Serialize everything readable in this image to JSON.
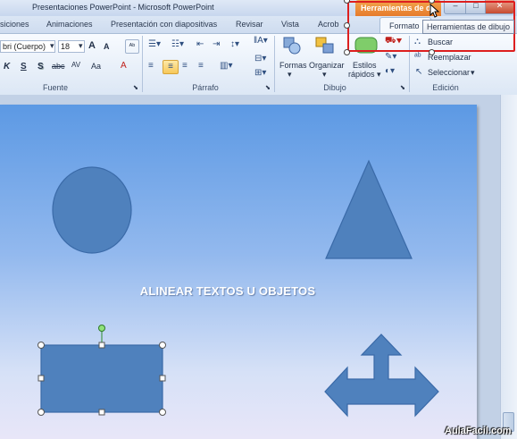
{
  "window": {
    "title": "Presentaciones PowerPoint - Microsoft PowerPoint",
    "contextual_tab": "Herramientas de d",
    "controls": {
      "minimize": "–",
      "maximize": "□",
      "close": "✕"
    }
  },
  "tabs": [
    "siciones",
    "Animaciones",
    "Presentación con diapositivas",
    "Revisar",
    "Vista",
    "Acrob",
    "Formato"
  ],
  "tooltip": "Herramientas de dibujo",
  "ribbon": {
    "font_group": {
      "label": "Fuente",
      "font_name": "bri (Cuerpo)",
      "font_size": "18",
      "grow": "A",
      "shrink": "A",
      "clear": "ᴬᵇ",
      "italic": "K",
      "underline": "S",
      "shadow": "S",
      "strike": "abc",
      "spacing": "AV",
      "case": "Aa",
      "color": "A"
    },
    "paragraph_group": {
      "label": "Párrafo"
    },
    "drawing_group": {
      "label": "Dibujo",
      "shapes": "Formas",
      "arrange": "Organizar",
      "styles_line1": "Estilos",
      "styles_line2": "rápidos"
    },
    "editing_group": {
      "label": "Edición",
      "find": "Buscar",
      "replace": "Reemplazar",
      "select": "Seleccionar"
    }
  },
  "slide": {
    "title_text": "ALINEAR TEXTOS U OBJETOS",
    "shape_fill": "#4f81bd",
    "shape_stroke": "#3a6aa8"
  },
  "watermark": "AulaFacil.com",
  "colors": {
    "highlight_red": "#dd1f1f",
    "contextual_orange": "#e6792a"
  }
}
